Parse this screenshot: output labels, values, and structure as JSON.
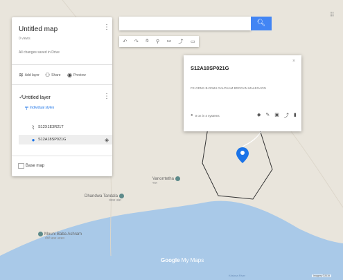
{
  "map_panel": {
    "title": "Untitled map",
    "subtitle": "0 views",
    "saved_status": "All changes saved in Drive",
    "actions": [
      {
        "label": "Add layer",
        "icon": "add-layer-icon"
      },
      {
        "label": "Share",
        "icon": "share-icon"
      },
      {
        "label": "Preview",
        "icon": "preview-icon"
      }
    ],
    "layer": {
      "title": "Untitled layer",
      "styles_link": "Individual styles",
      "items": [
        {
          "label": "S12X1E3R21T",
          "icon": "line-icon"
        },
        {
          "label": "S12A18SP021G",
          "icon": "marker-icon",
          "selected": true
        }
      ]
    },
    "base_map": "Base map"
  },
  "search": {
    "placeholder": "",
    "button_icon": "search-icon"
  },
  "toolbar": {
    "icons": [
      "undo-icon",
      "redo-icon",
      "hand-icon",
      "marker-icon",
      "line-icon",
      "directions-icon",
      "ruler-icon"
    ]
  },
  "popup": {
    "title": "S12A18SP021G",
    "description": "FE-GDM1 B-D0M4 GALPHAM BROGAN MALEGAON",
    "footer_text": "0 on in 4 systems",
    "tools": [
      "paint-icon",
      "edit-icon",
      "camera-icon",
      "directions-icon",
      "delete-icon"
    ]
  },
  "map_labels": [
    {
      "text": "Vanorrtetha",
      "sub": "नाल"
    },
    {
      "text": "Dhandwa Tandala",
      "sub": "धंधवा तांडा"
    },
    {
      "text": "Mouni Baba Ashram",
      "sub": "मौनी बाबा आश्रम"
    }
  ],
  "logo": {
    "google": "Google",
    "suffix": "My Maps"
  },
  "copyright": "Imagery ©2019",
  "river_label": "Krishna River",
  "colors": {
    "water": "#a9c9e8",
    "land": "#e9e5dc",
    "accent": "#4285f4",
    "polygon": "#333333"
  }
}
